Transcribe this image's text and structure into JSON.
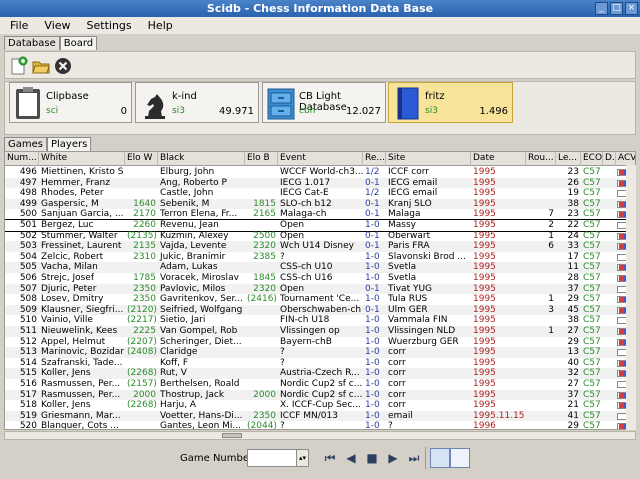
{
  "window": {
    "title": "Scidb - Chess Information Data Base"
  },
  "menu": [
    "File",
    "View",
    "Settings",
    "Help"
  ],
  "top_tabs": [
    "Database",
    "Board"
  ],
  "toolbar": {
    "icons": [
      "new-database-icon",
      "open-folder-icon",
      "close-database-icon"
    ]
  },
  "databases": [
    {
      "name": "Clipbase",
      "type": "sci",
      "count": "0",
      "icon": "clipboard-icon"
    },
    {
      "name": "k-ind",
      "type": "si3",
      "count": "49.971",
      "icon": "knight-icon"
    },
    {
      "name": "CB Light Database",
      "type": "cbh",
      "count": "12.027",
      "icon": "cabinet-icon"
    },
    {
      "name": "fritz",
      "type": "si3",
      "count": "1.496",
      "icon": "book-icon"
    }
  ],
  "mid_tabs": [
    "Games",
    "Players"
  ],
  "table": {
    "columns": [
      "Num...",
      "White",
      "Elo W",
      "Black",
      "Elo B",
      "Event",
      "Re...",
      "Site",
      "Date",
      "Rou...",
      "Le...",
      "ECO",
      "D...",
      "ACV"
    ],
    "rows": [
      [
        "496",
        "Miettinen, Kristo S",
        "",
        "Elburg, John",
        "",
        "WCCF World-ch3...",
        "1/2",
        "ICCF corr",
        "1995",
        "",
        "23",
        "C57"
      ],
      [
        "497",
        "Hemmer, Franz",
        "",
        "Ang, Roberto P",
        "",
        "IECG 1.017",
        "0-1",
        "IECG email",
        "1995",
        "",
        "26",
        "C57"
      ],
      [
        "498",
        "Rhodes, Peter",
        "",
        "Castle, John",
        "",
        "IECG Cat-E",
        "1/2",
        "IECG email",
        "1995",
        "",
        "19",
        "C57"
      ],
      [
        "499",
        "Gaspersic, M",
        "1640",
        "Sebenik, M",
        "1815",
        "SLO-ch b12",
        "0-1",
        "Kranj SLO",
        "1995",
        "",
        "38",
        "C57"
      ],
      [
        "500",
        "Sanjuan Garcia, ...",
        "2170",
        "Terron Elena, Fr...",
        "2165",
        "Malaga-ch",
        "0-1",
        "Malaga",
        "1995",
        "7",
        "23",
        "C57"
      ],
      [
        "501",
        "Bergez, Luc",
        "2260",
        "Revenu, Jean",
        "",
        "Open",
        "1-0",
        "Massy",
        "1995",
        "2",
        "22",
        "C57"
      ],
      [
        "502",
        "Stummer, Walter",
        "(2135)",
        "Kuzmin, Alexey",
        "2500",
        "Open",
        "0-1",
        "Oberwart",
        "1995",
        "1",
        "24",
        "C57"
      ],
      [
        "503",
        "Fressinet, Laurent",
        "2135",
        "Vajda, Levente",
        "2320",
        "Wch U14 Disney",
        "0-1",
        "Paris FRA",
        "1995",
        "6",
        "33",
        "C57"
      ],
      [
        "504",
        "Zelcic, Robert",
        "2310",
        "Jukic, Branimir",
        "2385",
        "?",
        "1-0",
        "Slavonski Brod ...",
        "1995",
        "",
        "17",
        "C57"
      ],
      [
        "505",
        "Vacha, Milan",
        "",
        "Adam, Lukas",
        "",
        "CSS-ch U10",
        "1-0",
        "Svetla",
        "1995",
        "",
        "11",
        "C57"
      ],
      [
        "506",
        "Strejc, Josef",
        "1785",
        "Voracek, Miroslav",
        "1845",
        "CSS-ch U16",
        "1-0",
        "Svetla",
        "1995",
        "",
        "28",
        "C57"
      ],
      [
        "507",
        "Djuric, Peter",
        "2350",
        "Pavlovic, Milos",
        "2320",
        "Open",
        "0-1",
        "Tivat YUG",
        "1995",
        "",
        "37",
        "C57"
      ],
      [
        "508",
        "Losev, Dmitry",
        "2350",
        "Gavritenkov, Ser...",
        "(2416)",
        "Tournament 'Ce...",
        "1-0",
        "Tula RUS",
        "1995",
        "1",
        "29",
        "C57"
      ],
      [
        "509",
        "Klausner, Siegfri...",
        "(2120)",
        "Seifried, Wolfgang",
        "",
        "Oberschwaben-ch",
        "0-1",
        "Ulm GER",
        "1995",
        "3",
        "45",
        "C57"
      ],
      [
        "510",
        "Vainio, Ville",
        "(2217)",
        "Sietio, Jari",
        "",
        "FIN-ch U18",
        "1-0",
        "Vammala FIN",
        "1995",
        "",
        "38",
        "C57"
      ],
      [
        "511",
        "Nieuwelink, Kees",
        "2225",
        "Van Gompel, Rob",
        "",
        "Vlissingen op",
        "1-0",
        "Vlissingen NLD",
        "1995",
        "1",
        "27",
        "C57"
      ],
      [
        "512",
        "Appel, Helmut",
        "(2207)",
        "Scheringer, Diet...",
        "",
        "Bayern-chB",
        "1-0",
        "Wuerzburg GER",
        "1995",
        "",
        "29",
        "C57"
      ],
      [
        "513",
        "Marinovic, Bozidar",
        "(2408)",
        "Claridge",
        "",
        "?",
        "1-0",
        "corr",
        "1995",
        "",
        "13",
        "C57"
      ],
      [
        "514",
        "Szafranski, Tade...",
        "",
        "Koff, F",
        "",
        "?",
        "1-0",
        "corr",
        "1995",
        "",
        "40",
        "C57"
      ],
      [
        "515",
        "Koller, Jens",
        "(2268)",
        "Rut, V",
        "",
        "Austria-Czech R...",
        "1-0",
        "corr",
        "1995",
        "",
        "32",
        "C57"
      ],
      [
        "516",
        "Rasmussen, Per...",
        "(2157)",
        "Berthelsen, Roald",
        "",
        "Nordic Cup2 sf c...",
        "1-0",
        "corr",
        "1995",
        "",
        "27",
        "C57"
      ],
      [
        "517",
        "Rasmussen, Per...",
        "2000",
        "Thostrup, Jack",
        "2000",
        "Nordic Cup2 sf c...",
        "1-0",
        "corr",
        "1995",
        "",
        "37",
        "C57"
      ],
      [
        "518",
        "Koller, Jens",
        "(2268)",
        "Harju, A",
        "",
        "X. ICCF-Cup Sec...",
        "1-0",
        "corr",
        "1995",
        "",
        "21",
        "C57"
      ],
      [
        "519",
        "Griesmann, Mar...",
        "",
        "Voetter, Hans-Di...",
        "2350",
        "ICCF MN/013",
        "1-0",
        "email",
        "1995.11.15",
        "",
        "41",
        "C57"
      ],
      [
        "520",
        "Blanquer, Cots ...",
        "",
        "Gantes, Leon Mi...",
        "(2044)",
        "?",
        "1-0",
        "?",
        "1996",
        "",
        "29",
        "C57"
      ]
    ],
    "selected_index": 5
  },
  "status": {
    "game_number_label": "Game Number:",
    "game_number_value": "",
    "nav_icons": [
      "first-icon",
      "previous-icon",
      "stop-icon",
      "next-icon",
      "last-icon"
    ]
  }
}
